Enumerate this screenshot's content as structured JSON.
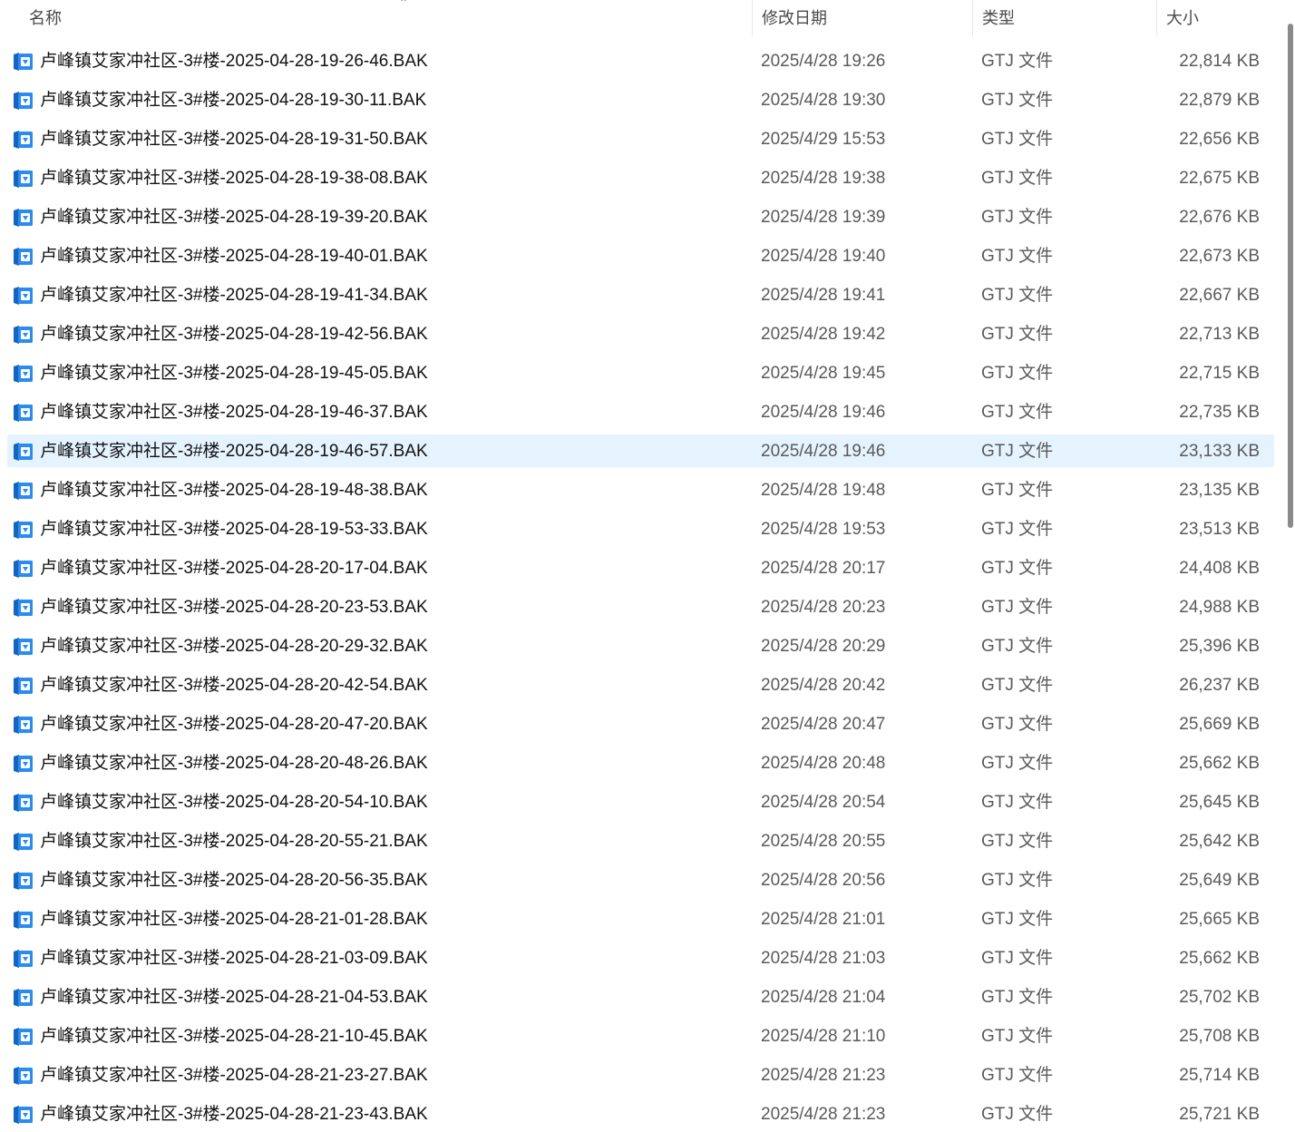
{
  "columns": {
    "name": "名称",
    "date": "修改日期",
    "type": "类型",
    "size": "大小"
  },
  "sort_indicator": "^",
  "accent_color": "#1a73e8",
  "selected_row_color": "#e5f3fe",
  "icon": "gtj-file-icon",
  "files": [
    {
      "name": "卢峰镇艾家冲社区-3#楼-2025-04-28-19-26-46.BAK",
      "date": "2025/4/28 19:26",
      "type": "GTJ 文件",
      "size": "22,814 KB"
    },
    {
      "name": "卢峰镇艾家冲社区-3#楼-2025-04-28-19-30-11.BAK",
      "date": "2025/4/28 19:30",
      "type": "GTJ 文件",
      "size": "22,879 KB"
    },
    {
      "name": "卢峰镇艾家冲社区-3#楼-2025-04-28-19-31-50.BAK",
      "date": "2025/4/29 15:53",
      "type": "GTJ 文件",
      "size": "22,656 KB"
    },
    {
      "name": "卢峰镇艾家冲社区-3#楼-2025-04-28-19-38-08.BAK",
      "date": "2025/4/28 19:38",
      "type": "GTJ 文件",
      "size": "22,675 KB"
    },
    {
      "name": "卢峰镇艾家冲社区-3#楼-2025-04-28-19-39-20.BAK",
      "date": "2025/4/28 19:39",
      "type": "GTJ 文件",
      "size": "22,676 KB"
    },
    {
      "name": "卢峰镇艾家冲社区-3#楼-2025-04-28-19-40-01.BAK",
      "date": "2025/4/28 19:40",
      "type": "GTJ 文件",
      "size": "22,673 KB"
    },
    {
      "name": "卢峰镇艾家冲社区-3#楼-2025-04-28-19-41-34.BAK",
      "date": "2025/4/28 19:41",
      "type": "GTJ 文件",
      "size": "22,667 KB"
    },
    {
      "name": "卢峰镇艾家冲社区-3#楼-2025-04-28-19-42-56.BAK",
      "date": "2025/4/28 19:42",
      "type": "GTJ 文件",
      "size": "22,713 KB"
    },
    {
      "name": "卢峰镇艾家冲社区-3#楼-2025-04-28-19-45-05.BAK",
      "date": "2025/4/28 19:45",
      "type": "GTJ 文件",
      "size": "22,715 KB"
    },
    {
      "name": "卢峰镇艾家冲社区-3#楼-2025-04-28-19-46-37.BAK",
      "date": "2025/4/28 19:46",
      "type": "GTJ 文件",
      "size": "22,735 KB"
    },
    {
      "name": "卢峰镇艾家冲社区-3#楼-2025-04-28-19-46-57.BAK",
      "date": "2025/4/28 19:46",
      "type": "GTJ 文件",
      "size": "23,133 KB",
      "selected": true
    },
    {
      "name": "卢峰镇艾家冲社区-3#楼-2025-04-28-19-48-38.BAK",
      "date": "2025/4/28 19:48",
      "type": "GTJ 文件",
      "size": "23,135 KB"
    },
    {
      "name": "卢峰镇艾家冲社区-3#楼-2025-04-28-19-53-33.BAK",
      "date": "2025/4/28 19:53",
      "type": "GTJ 文件",
      "size": "23,513 KB"
    },
    {
      "name": "卢峰镇艾家冲社区-3#楼-2025-04-28-20-17-04.BAK",
      "date": "2025/4/28 20:17",
      "type": "GTJ 文件",
      "size": "24,408 KB"
    },
    {
      "name": "卢峰镇艾家冲社区-3#楼-2025-04-28-20-23-53.BAK",
      "date": "2025/4/28 20:23",
      "type": "GTJ 文件",
      "size": "24,988 KB"
    },
    {
      "name": "卢峰镇艾家冲社区-3#楼-2025-04-28-20-29-32.BAK",
      "date": "2025/4/28 20:29",
      "type": "GTJ 文件",
      "size": "25,396 KB"
    },
    {
      "name": "卢峰镇艾家冲社区-3#楼-2025-04-28-20-42-54.BAK",
      "date": "2025/4/28 20:42",
      "type": "GTJ 文件",
      "size": "26,237 KB"
    },
    {
      "name": "卢峰镇艾家冲社区-3#楼-2025-04-28-20-47-20.BAK",
      "date": "2025/4/28 20:47",
      "type": "GTJ 文件",
      "size": "25,669 KB"
    },
    {
      "name": "卢峰镇艾家冲社区-3#楼-2025-04-28-20-48-26.BAK",
      "date": "2025/4/28 20:48",
      "type": "GTJ 文件",
      "size": "25,662 KB"
    },
    {
      "name": "卢峰镇艾家冲社区-3#楼-2025-04-28-20-54-10.BAK",
      "date": "2025/4/28 20:54",
      "type": "GTJ 文件",
      "size": "25,645 KB"
    },
    {
      "name": "卢峰镇艾家冲社区-3#楼-2025-04-28-20-55-21.BAK",
      "date": "2025/4/28 20:55",
      "type": "GTJ 文件",
      "size": "25,642 KB"
    },
    {
      "name": "卢峰镇艾家冲社区-3#楼-2025-04-28-20-56-35.BAK",
      "date": "2025/4/28 20:56",
      "type": "GTJ 文件",
      "size": "25,649 KB"
    },
    {
      "name": "卢峰镇艾家冲社区-3#楼-2025-04-28-21-01-28.BAK",
      "date": "2025/4/28 21:01",
      "type": "GTJ 文件",
      "size": "25,665 KB"
    },
    {
      "name": "卢峰镇艾家冲社区-3#楼-2025-04-28-21-03-09.BAK",
      "date": "2025/4/28 21:03",
      "type": "GTJ 文件",
      "size": "25,662 KB"
    },
    {
      "name": "卢峰镇艾家冲社区-3#楼-2025-04-28-21-04-53.BAK",
      "date": "2025/4/28 21:04",
      "type": "GTJ 文件",
      "size": "25,702 KB"
    },
    {
      "name": "卢峰镇艾家冲社区-3#楼-2025-04-28-21-10-45.BAK",
      "date": "2025/4/28 21:10",
      "type": "GTJ 文件",
      "size": "25,708 KB"
    },
    {
      "name": "卢峰镇艾家冲社区-3#楼-2025-04-28-21-23-27.BAK",
      "date": "2025/4/28 21:23",
      "type": "GTJ 文件",
      "size": "25,714 KB"
    },
    {
      "name": "卢峰镇艾家冲社区-3#楼-2025-04-28-21-23-43.BAK",
      "date": "2025/4/28 21:23",
      "type": "GTJ 文件",
      "size": "25,721 KB"
    }
  ]
}
